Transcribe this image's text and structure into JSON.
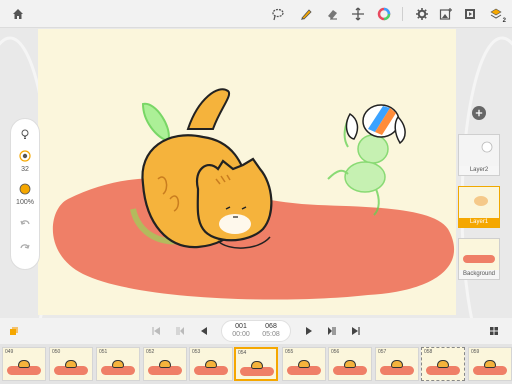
{
  "toolbar": {
    "icons": [
      "home-icon",
      "lasso-icon",
      "pencil-icon",
      "eraser-icon",
      "move-icon",
      "color-wheel-icon",
      "gear-icon",
      "image-add-icon",
      "film-icon",
      "stack-icon"
    ],
    "stack_badge": "2"
  },
  "tools": {
    "brush_size": "32",
    "opacity": "100%",
    "colors": {
      "brush": "#f5a700",
      "accent": "#f5a700"
    }
  },
  "layers": {
    "items": [
      {
        "name": "Layer2"
      },
      {
        "name": "Layer1"
      },
      {
        "name": "Background"
      }
    ],
    "active": "Layer1"
  },
  "playback": {
    "current_frame": "001",
    "current_time": "00:00",
    "total_frames": "068",
    "total_time": "05:08"
  },
  "filmstrip": {
    "frames": [
      "049",
      "050",
      "051",
      "052",
      "053",
      "054",
      "055",
      "056",
      "057",
      "058",
      "059"
    ],
    "current": "054"
  },
  "colors": {
    "canvas": "#fbf6dc",
    "blob": "#ef7f67",
    "cat": "#f5b33c",
    "ghost": "#7de36d",
    "accent": "#f5a700"
  }
}
